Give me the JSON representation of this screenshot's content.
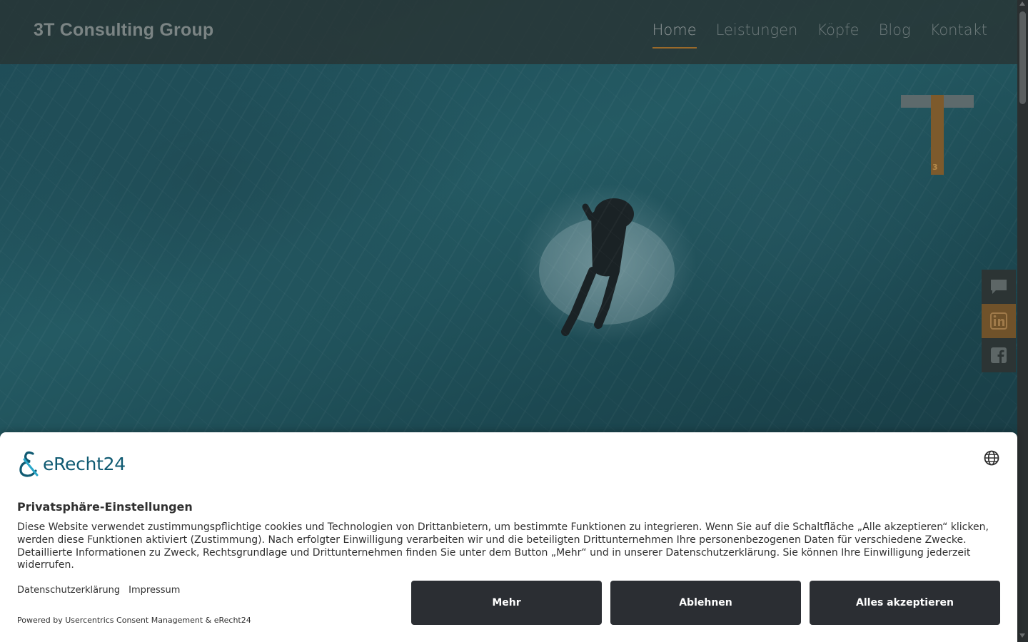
{
  "header": {
    "brand": "3T Consulting Group",
    "nav": [
      {
        "label": "Home",
        "active": true
      },
      {
        "label": "Leistungen",
        "active": false
      },
      {
        "label": "Köpfe",
        "active": false
      },
      {
        "label": "Blog",
        "active": false
      },
      {
        "label": "Kontakt",
        "active": false
      }
    ]
  },
  "logo": {
    "mini": "3"
  },
  "social": [
    {
      "icon": "chat-icon"
    },
    {
      "icon": "linkedin-icon"
    },
    {
      "icon": "facebook-icon"
    }
  ],
  "consent": {
    "logo_text": "eRecht24",
    "title": "Privatsphäre-Einstellungen",
    "body": "Diese Website verwendet zustimmungspflichtige cookies und Technologien von Drittanbietern, um bestimmte Funktionen zu integrieren. Wenn Sie auf die Schaltfläche „Alle akzeptieren“ klicken, werden diese Funktionen aktiviert (Zustimmung). Nach erfolgter Einwilligung verarbeiten wir und die beteiligten Drittunternehmen Ihre personenbezogenen Daten für verschiedene Zwecke. Detaillierte Informationen zu Zweck, Rechtsgrundlage und Drittunternehmen finden Sie unter dem Button „Mehr“ und in unserer Datenschutzerklärung. Sie können Ihre Einwilligung jederzeit widerrufen.",
    "links": {
      "privacy": "Datenschutzerklärung",
      "imprint": "Impressum"
    },
    "powered": "Powered by Usercentrics Consent Management & eRecht24",
    "buttons": {
      "more": "Mehr",
      "decline": "Ablehnen",
      "accept_all": "Alles akzeptieren"
    }
  },
  "colors": {
    "accent": "#9a6a2a",
    "button_bg": "#2b2e33",
    "logo_blue": "#0f5a72"
  }
}
